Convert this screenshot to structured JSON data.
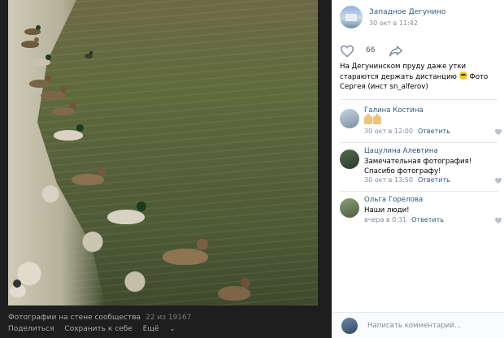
{
  "photo_viewer": {
    "caption": "Фотографии на стене сообщества",
    "counter": "22 из 19167",
    "actions": [
      "Поделиться",
      "Сохранить к себе",
      "Ещё"
    ],
    "more_glyph": "⌄"
  },
  "post": {
    "community": "Западное Дегунино",
    "date": "30 окт в 11:42",
    "likes": "66",
    "text_before_emoji": "На Дегунинском пруду даже утки стараются держать дистанцию",
    "text_after_emoji": "Фото Сергея (инст sn_alferov)"
  },
  "comments": [
    {
      "author": "Галина Костина",
      "text": "",
      "thumbs_count": 2,
      "date": "30 окт в 12:00",
      "reply_label": "Ответить"
    },
    {
      "author": "Цацулина Алевтина",
      "text": "Замечательная фотография! Спасибо фотографу!",
      "date": "30 окт в 13:50",
      "reply_label": "Ответить"
    },
    {
      "author": "Ольга Горелова",
      "text": "Наши люди!",
      "date": "вчера в 0:31",
      "reply_label": "Ответить"
    }
  ],
  "composer": {
    "placeholder": "Написать комментарий..."
  },
  "colors": {
    "link": "#2a5885",
    "muted": "#818c99",
    "viewer_bg": "#1e1e1e"
  }
}
